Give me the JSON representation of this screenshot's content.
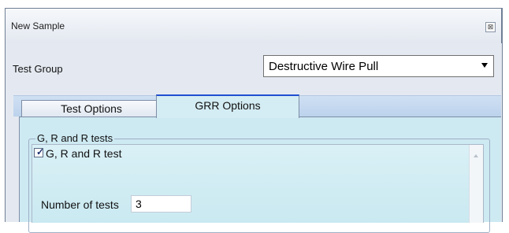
{
  "window": {
    "title": "New Sample",
    "close_symbol": "⊠"
  },
  "test_group": {
    "label": "Test Group",
    "selected": "Destructive Wire Pull"
  },
  "tabs": [
    {
      "label": "Test Options",
      "active": false
    },
    {
      "label": "GRR Options",
      "active": true
    }
  ],
  "grr": {
    "group_title": "G, R and R tests",
    "checkbox_label": "G, R and R test",
    "checkbox_checked": true,
    "number_of_tests_label": "Number of tests",
    "number_of_tests_value": "3"
  },
  "colors": {
    "active_tab_accent": "#1f4ed1",
    "panel_bg": "#cde9f2"
  }
}
